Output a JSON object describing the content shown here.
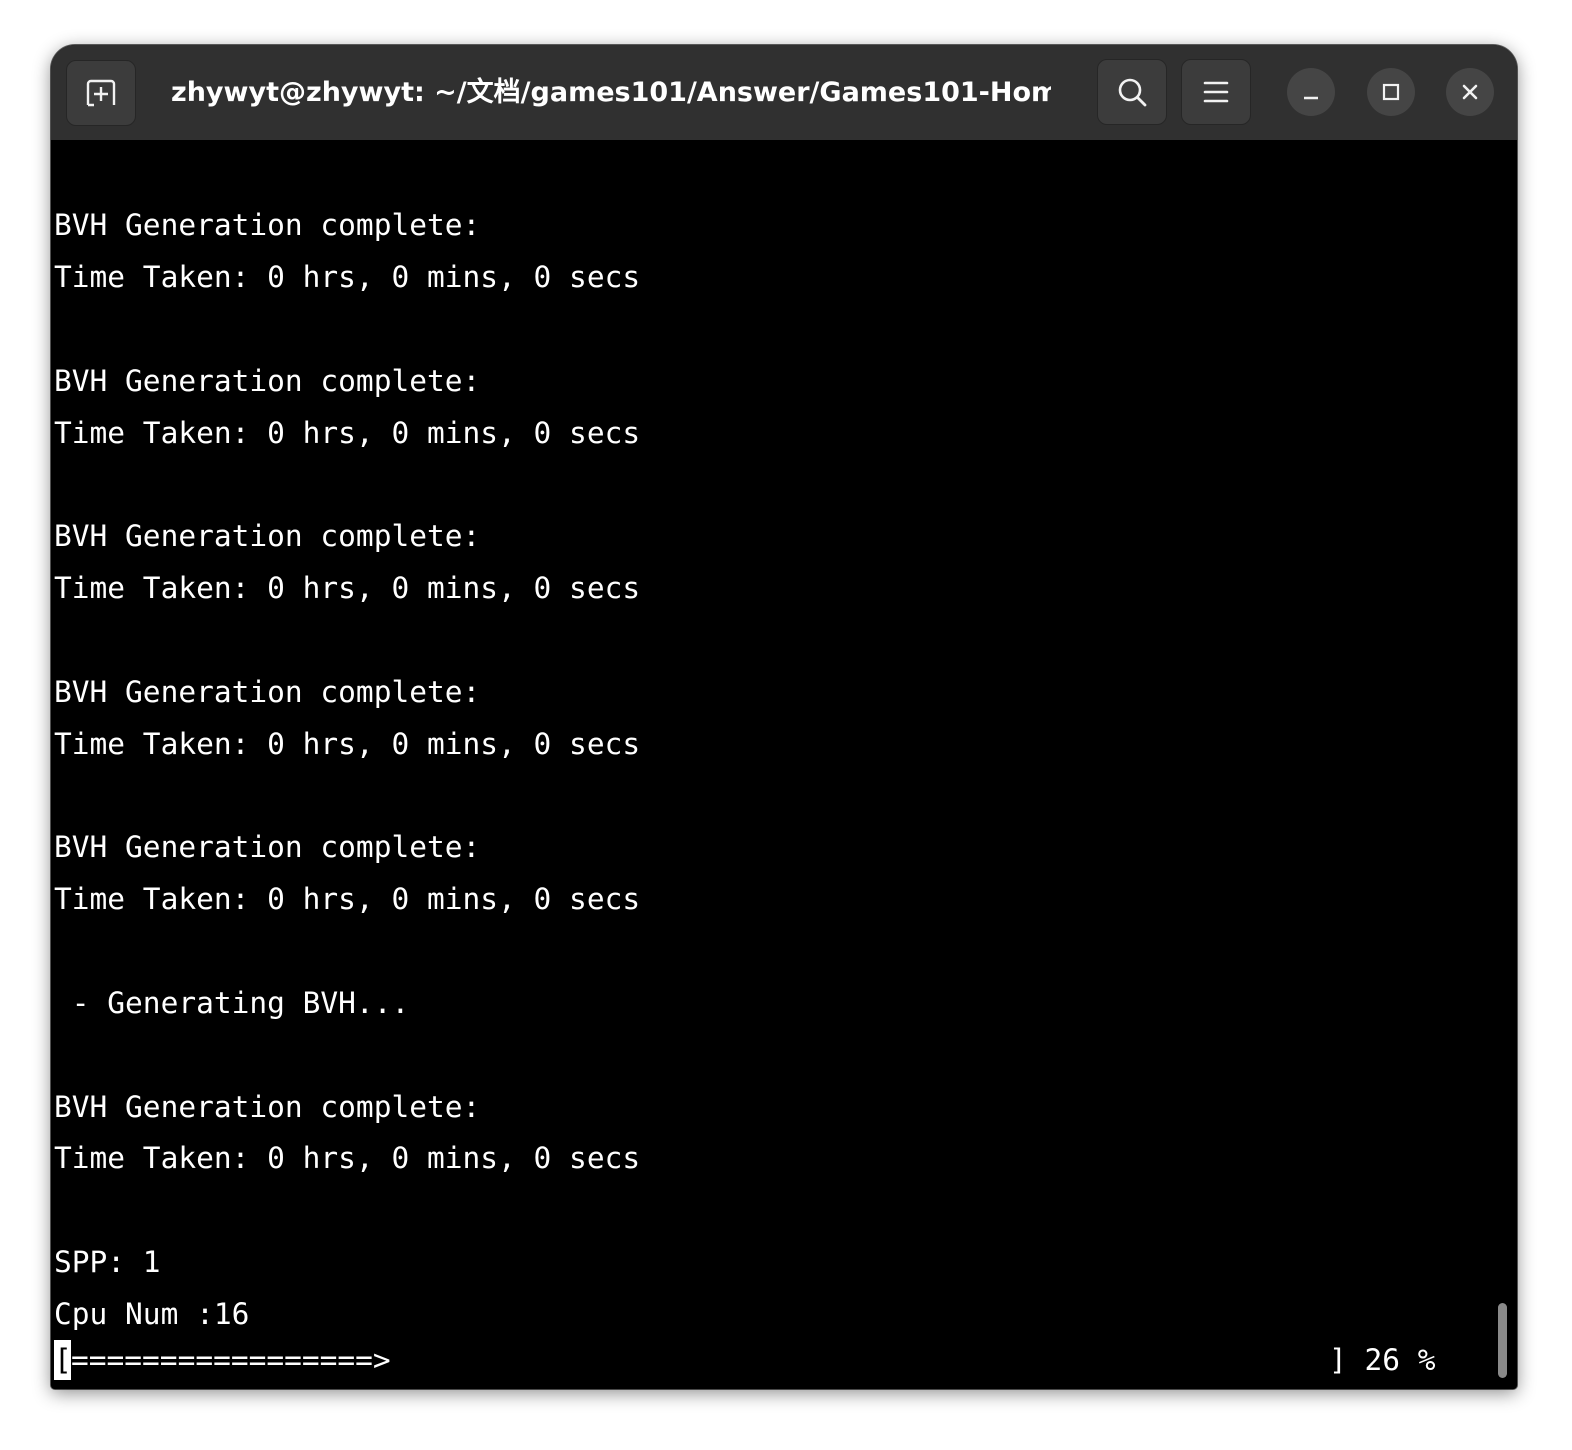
{
  "window": {
    "title": "zhywyt@zhywyt: ~/文档/games101/Answer/Games101-Home..."
  },
  "toolbar": {
    "new_tab_icon": "new-tab-icon",
    "search_icon": "search-icon",
    "menu_icon": "hamburger-menu-icon",
    "minimize_icon": "minimize-icon",
    "maximize_icon": "maximize-icon",
    "close_icon": "close-icon"
  },
  "terminal": {
    "lines": [
      "",
      "BVH Generation complete:",
      "Time Taken: 0 hrs, 0 mins, 0 secs",
      "",
      "BVH Generation complete:",
      "Time Taken: 0 hrs, 0 mins, 0 secs",
      "",
      "BVH Generation complete:",
      "Time Taken: 0 hrs, 0 mins, 0 secs",
      "",
      "BVH Generation complete:",
      "Time Taken: 0 hrs, 0 mins, 0 secs",
      "",
      "BVH Generation complete:",
      "Time Taken: 0 hrs, 0 mins, 0 secs",
      "",
      " - Generating BVH...",
      "",
      "BVH Generation complete:",
      "Time Taken: 0 hrs, 0 mins, 0 secs",
      "",
      "SPP: 1",
      "Cpu Num :16"
    ],
    "progress": {
      "open_bracket": "[",
      "bar": "=================>",
      "close_bracket": "] 26 %",
      "percent": 26
    }
  },
  "colors": {
    "titlebar": "#303030",
    "terminal_bg": "#000000",
    "terminal_fg": "#ffffff"
  }
}
